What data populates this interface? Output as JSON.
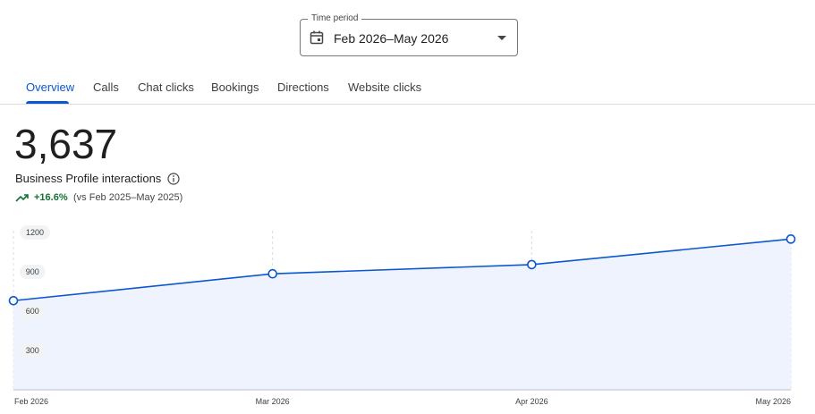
{
  "time_period": {
    "label": "Time period",
    "value": "Feb 2026–May 2026"
  },
  "tabs": [
    {
      "label": "Overview",
      "active": true
    },
    {
      "label": "Calls",
      "active": false
    },
    {
      "label": "Chat clicks",
      "active": false
    },
    {
      "label": "Bookings",
      "active": false
    },
    {
      "label": "Directions",
      "active": false
    },
    {
      "label": "Website clicks",
      "active": false
    }
  ],
  "summary": {
    "total": "3,637",
    "label": "Business Profile interactions",
    "change": "+16.6%",
    "comparison": "(vs Feb 2025–May 2025)"
  },
  "colors": {
    "accent": "#0b57d0",
    "positive": "#137333",
    "area_fill": "#eef3fd"
  },
  "chart_data": {
    "type": "area",
    "categories": [
      "Feb 2026",
      "Mar 2026",
      "Apr 2026",
      "May 2026"
    ],
    "values": [
      680,
      885,
      955,
      1150
    ],
    "yticks": [
      300,
      600,
      900,
      1200
    ],
    "ylim": [
      0,
      1200
    ],
    "grid": true
  }
}
